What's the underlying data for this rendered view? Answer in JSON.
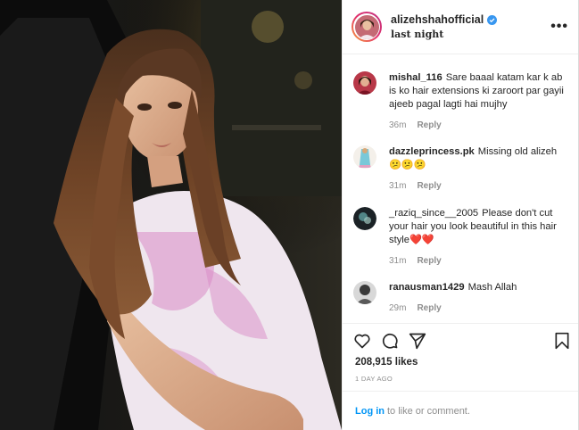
{
  "header": {
    "username": "alizehshahofficial",
    "subtitle": "last night",
    "more_icon": "more-horizontal-icon"
  },
  "comments": [
    {
      "username": "mishal_116",
      "text": "Sare baaal katam kar k ab is ko hair extensions ki zaroort par gayii ajeeb pagal lagti hai mujhy",
      "time": "36m",
      "reply": "Reply"
    },
    {
      "username": "dazzleprincess.pk",
      "text": "Missing old alizeh 😕😕😕",
      "time": "31m",
      "reply": "Reply"
    },
    {
      "username": "_raziq_since__2005",
      "text": "Please don't cut your hair you look beautiful in this hair style❤️❤️",
      "time": "31m",
      "reply": "Reply"
    },
    {
      "username": "ranausman1429",
      "text": "Mash Allah",
      "time": "29m",
      "reply": "Reply"
    }
  ],
  "actions": {
    "likes": "208,915 likes",
    "date": "1 DAY AGO"
  },
  "footer": {
    "login_label": "Log in",
    "rest_text": "to like or comment."
  },
  "colors": {
    "accent": "#0095f6",
    "verified": "#3897f0",
    "text": "#262626",
    "muted": "#8e8e8e",
    "heart": "#c0392b"
  }
}
